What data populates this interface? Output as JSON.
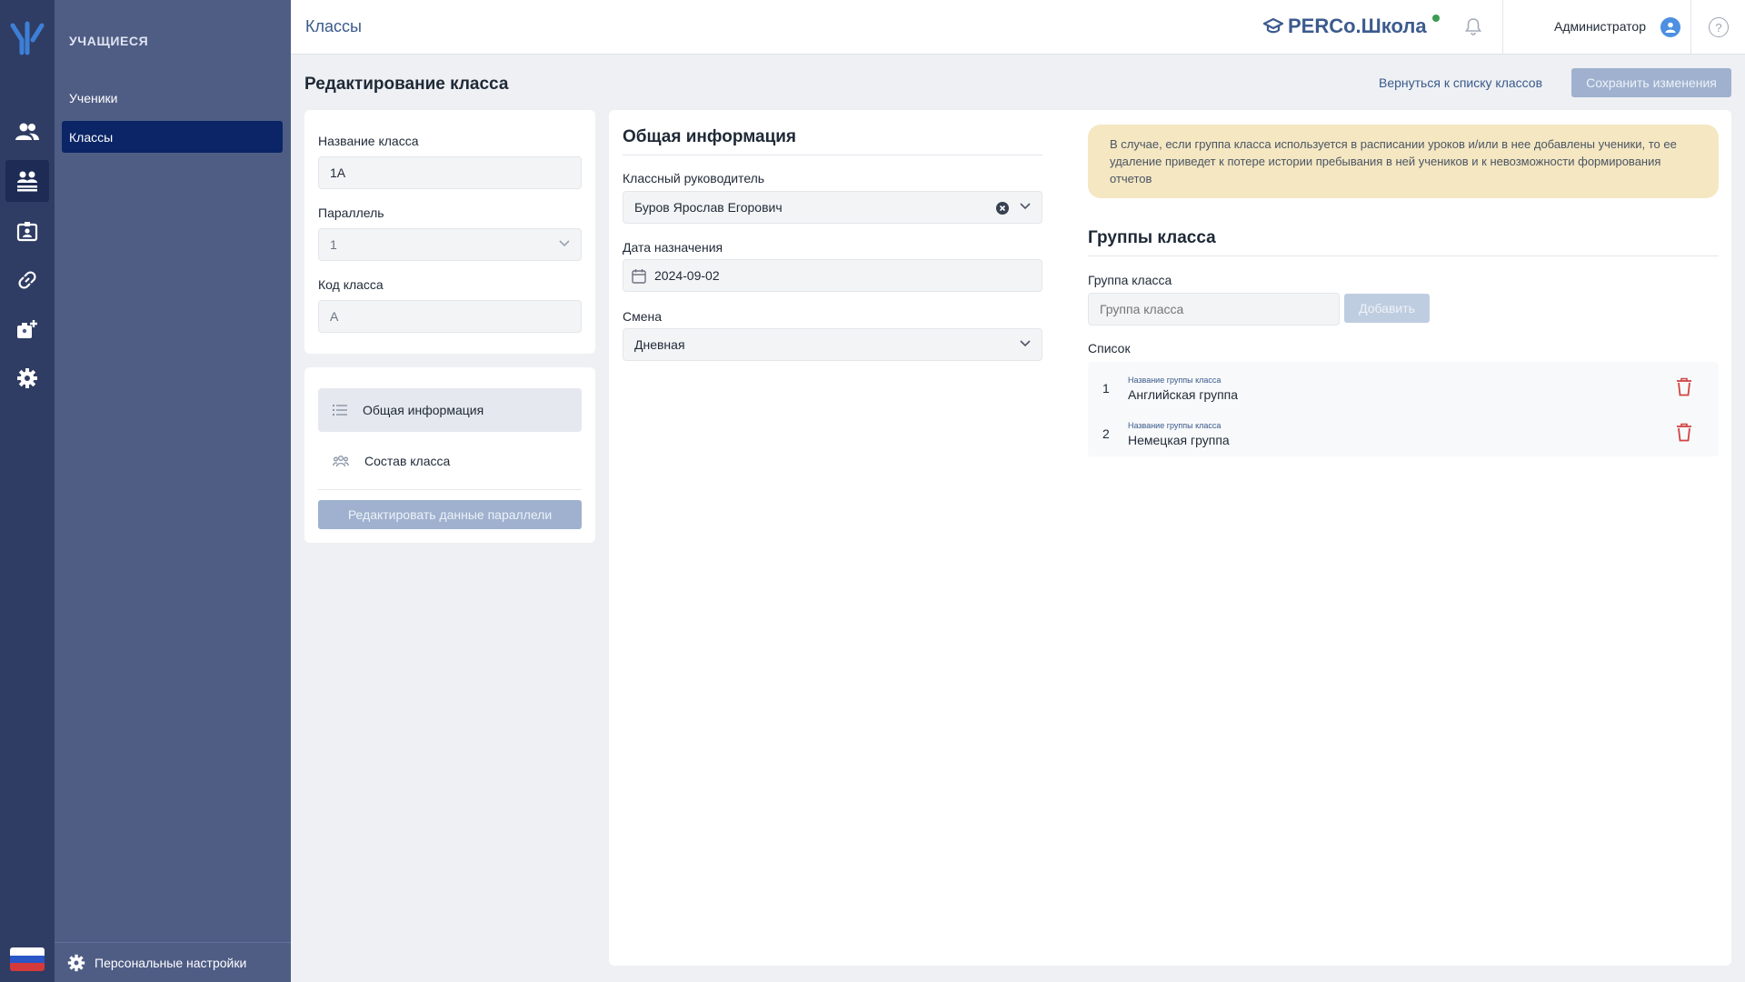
{
  "sidebar": {
    "section_title": "УЧАЩИЕСЯ",
    "items": [
      {
        "label": "Ученики"
      },
      {
        "label": "Классы"
      }
    ],
    "personal_settings": "Персональные настройки"
  },
  "header": {
    "breadcrumb": "Классы",
    "brand": "PERCo.Школа",
    "user": "Администратор",
    "help": "?"
  },
  "page": {
    "title": "Редактирование класса",
    "back_link": "Вернуться к списку классов",
    "save_button": "Сохранить изменения"
  },
  "class_form": {
    "name_label": "Название класса",
    "name_value": "1А",
    "parallel_label": "Параллель",
    "parallel_value": "1",
    "code_label": "Код класса",
    "code_value": "А"
  },
  "section_nav": {
    "items": [
      {
        "label": "Общая информация"
      },
      {
        "label": "Состав класса"
      }
    ],
    "edit_parallel_button": "Редактировать данные параллели"
  },
  "general_info": {
    "title": "Общая информация",
    "teacher_label": "Классный руководитель",
    "teacher_value": "Буров Ярослав Егорович",
    "date_label": "Дата назначения",
    "date_value": "2024-09-02",
    "shift_label": "Смена",
    "shift_value": "Дневная"
  },
  "groups": {
    "warning": "В случае, если группа класса используется в расписании уроков и/или в нее добавлены ученики, то ее удаление приведет к потере истории пребывания в ней учеников и к невозможности формирования отчетов",
    "title": "Группы класса",
    "group_label": "Группа класса",
    "group_placeholder": "Группа класса",
    "add_button": "Добавить",
    "list_label": "Список",
    "list": [
      {
        "num": "1",
        "caption": "Название группы класса",
        "name": "Английская группа"
      },
      {
        "num": "2",
        "caption": "Название группы класса",
        "name": "Немецкая группа"
      }
    ]
  },
  "colors": {
    "rail": "#2f3c63",
    "sidebar": "#4f5d85",
    "active_item": "#0b2566",
    "accent": "#3a5a8c",
    "warning_bg": "#f4e7c2",
    "delete": "#d14343"
  }
}
